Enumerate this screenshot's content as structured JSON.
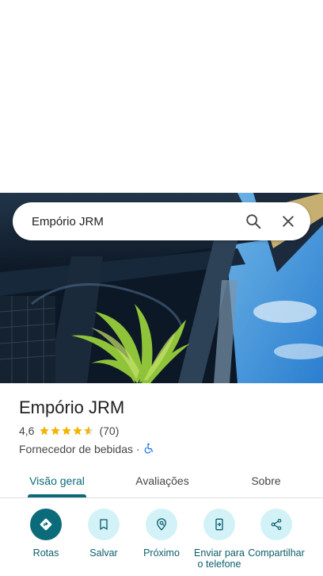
{
  "search": {
    "query": "Empório JRM",
    "search_icon": "search-icon",
    "close_icon": "close-icon"
  },
  "place": {
    "name": "Empório JRM",
    "rating_value": "4,6",
    "rating_stars": 4.6,
    "review_count": "(70)",
    "category": "Fornecedor de bebidas",
    "separator": "·",
    "accessibility_icon": "wheelchair-icon"
  },
  "tabs": [
    {
      "label": "Visão geral",
      "active": true
    },
    {
      "label": "Avaliações",
      "active": false
    },
    {
      "label": "Sobre",
      "active": false
    }
  ],
  "actions": [
    {
      "label": "Rotas",
      "icon": "directions-icon"
    },
    {
      "label": "Salvar",
      "icon": "bookmark-icon"
    },
    {
      "label": "Próximo",
      "icon": "nearby-icon"
    },
    {
      "label": "Enviar para o telefone",
      "icon": "send-to-phone-icon"
    },
    {
      "label": "Compartilhar",
      "icon": "share-icon"
    }
  ],
  "colors": {
    "accent": "#0b6b7a",
    "action_bg": "#d3f2f8",
    "star": "#f4b400"
  }
}
